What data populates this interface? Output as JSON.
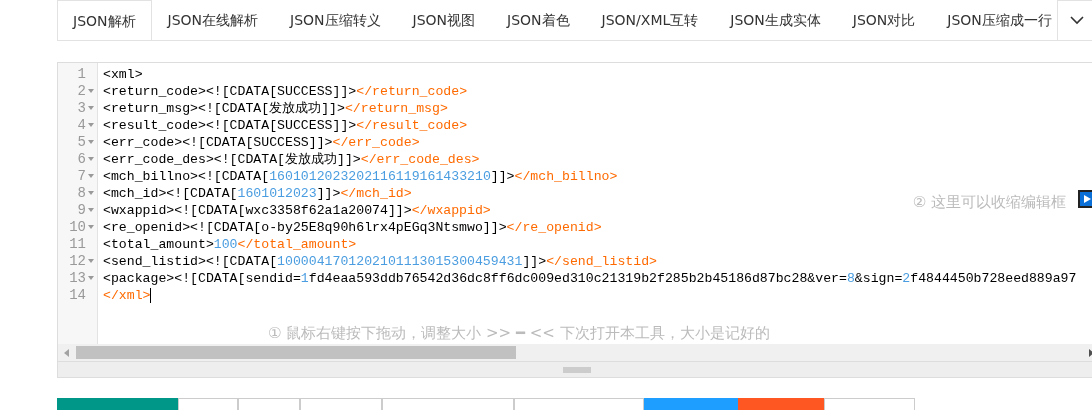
{
  "tabs": [
    {
      "label": "JSON解析",
      "selected": true
    },
    {
      "label": "JSON在线解析",
      "selected": false
    },
    {
      "label": "JSON压缩转义",
      "selected": false
    },
    {
      "label": "JSON视图",
      "selected": false
    },
    {
      "label": "JSON着色",
      "selected": false
    },
    {
      "label": "JSON/XML互转",
      "selected": false
    },
    {
      "label": "JSON生成实体",
      "selected": false
    },
    {
      "label": "JSON对比",
      "selected": false
    },
    {
      "label": "JSON压缩成一行",
      "selected": false
    }
  ],
  "editor": {
    "lines": [
      {
        "number": "1",
        "foldable": false,
        "segments": [
          {
            "kind": "text",
            "text": "<xml>"
          }
        ]
      },
      {
        "number": "2",
        "foldable": true,
        "segments": [
          {
            "kind": "text",
            "text": "<return_code><![CDATA[SUCCESS]]>"
          },
          {
            "kind": "close",
            "text": "</return_code>"
          }
        ]
      },
      {
        "number": "3",
        "foldable": true,
        "segments": [
          {
            "kind": "text",
            "text": "<return_msg><![CDATA[发放成功]]>"
          },
          {
            "kind": "close",
            "text": "</return_msg>"
          }
        ]
      },
      {
        "number": "4",
        "foldable": true,
        "segments": [
          {
            "kind": "text",
            "text": "<result_code><![CDATA[SUCCESS]]>"
          },
          {
            "kind": "close",
            "text": "</result_code>"
          }
        ]
      },
      {
        "number": "5",
        "foldable": true,
        "segments": [
          {
            "kind": "text",
            "text": "<err_code><![CDATA[SUCCESS]]>"
          },
          {
            "kind": "close",
            "text": "</err_code>"
          }
        ]
      },
      {
        "number": "6",
        "foldable": true,
        "segments": [
          {
            "kind": "text",
            "text": "<err_code_des><![CDATA[发放成功]]>"
          },
          {
            "kind": "close",
            "text": "</err_code_des>"
          }
        ]
      },
      {
        "number": "7",
        "foldable": true,
        "segments": [
          {
            "kind": "text",
            "text": "<mch_billno><![CDATA["
          },
          {
            "kind": "number",
            "text": "1601012023202116119161433210"
          },
          {
            "kind": "text",
            "text": "]]>"
          },
          {
            "kind": "close",
            "text": "</mch_billno>"
          }
        ]
      },
      {
        "number": "8",
        "foldable": true,
        "segments": [
          {
            "kind": "text",
            "text": "<mch_id><![CDATA["
          },
          {
            "kind": "number",
            "text": "1601012023"
          },
          {
            "kind": "text",
            "text": "]]>"
          },
          {
            "kind": "close",
            "text": "</mch_id>"
          }
        ]
      },
      {
        "number": "9",
        "foldable": true,
        "segments": [
          {
            "kind": "text",
            "text": "<wxappid><![CDATA[wxc3358f62a1a20074]]>"
          },
          {
            "kind": "close",
            "text": "</wxappid>"
          }
        ]
      },
      {
        "number": "10",
        "foldable": true,
        "segments": [
          {
            "kind": "text",
            "text": "<re_openid><![CDATA[o-by25E8q90h6lrx4pEGq3Ntsmwo]]>"
          },
          {
            "kind": "close",
            "text": "</re_openid>"
          }
        ]
      },
      {
        "number": "11",
        "foldable": false,
        "segments": [
          {
            "kind": "text",
            "text": "<total_amount>"
          },
          {
            "kind": "number",
            "text": "100"
          },
          {
            "kind": "close",
            "text": "</total_amount>"
          }
        ]
      },
      {
        "number": "12",
        "foldable": true,
        "segments": [
          {
            "kind": "text",
            "text": "<send_listid><![CDATA["
          },
          {
            "kind": "number",
            "text": "1000041701202101113015300459431"
          },
          {
            "kind": "text",
            "text": "]]>"
          },
          {
            "kind": "close",
            "text": "</send_listid>"
          }
        ]
      },
      {
        "number": "13",
        "foldable": true,
        "segments": [
          {
            "kind": "text",
            "text": "<package><![CDATA[sendid="
          },
          {
            "kind": "number",
            "text": "1"
          },
          {
            "kind": "text",
            "text": "fd4eaa593ddb76542d36dc8ff6dc009ed310c21319b2f285b2b45186d87bc28&ver="
          },
          {
            "kind": "number",
            "text": "8"
          },
          {
            "kind": "text",
            "text": "&sign="
          },
          {
            "kind": "number",
            "text": "2"
          },
          {
            "kind": "text",
            "text": "f4844450b728eed889a97"
          }
        ]
      },
      {
        "number": "14",
        "foldable": false,
        "segments": [
          {
            "kind": "close",
            "text": "</xml>"
          }
        ]
      }
    ],
    "collapse_hint": "② 这里可以收缩编辑框",
    "resize_hint": "① 鼠标右键按下拖动，调整大小 >> ━ << 下次打开本工具，大小是记好的"
  },
  "buttons": [
    {
      "color": "#009688"
    },
    {
      "color": "#ffffff"
    },
    {
      "color": "#ffffff"
    },
    {
      "color": "#ffffff"
    },
    {
      "color": "#ffffff"
    },
    {
      "color": "#ffffff"
    },
    {
      "color": "#1e9fff"
    },
    {
      "color": "#ff5722"
    },
    {
      "color": "#ffffff"
    }
  ]
}
